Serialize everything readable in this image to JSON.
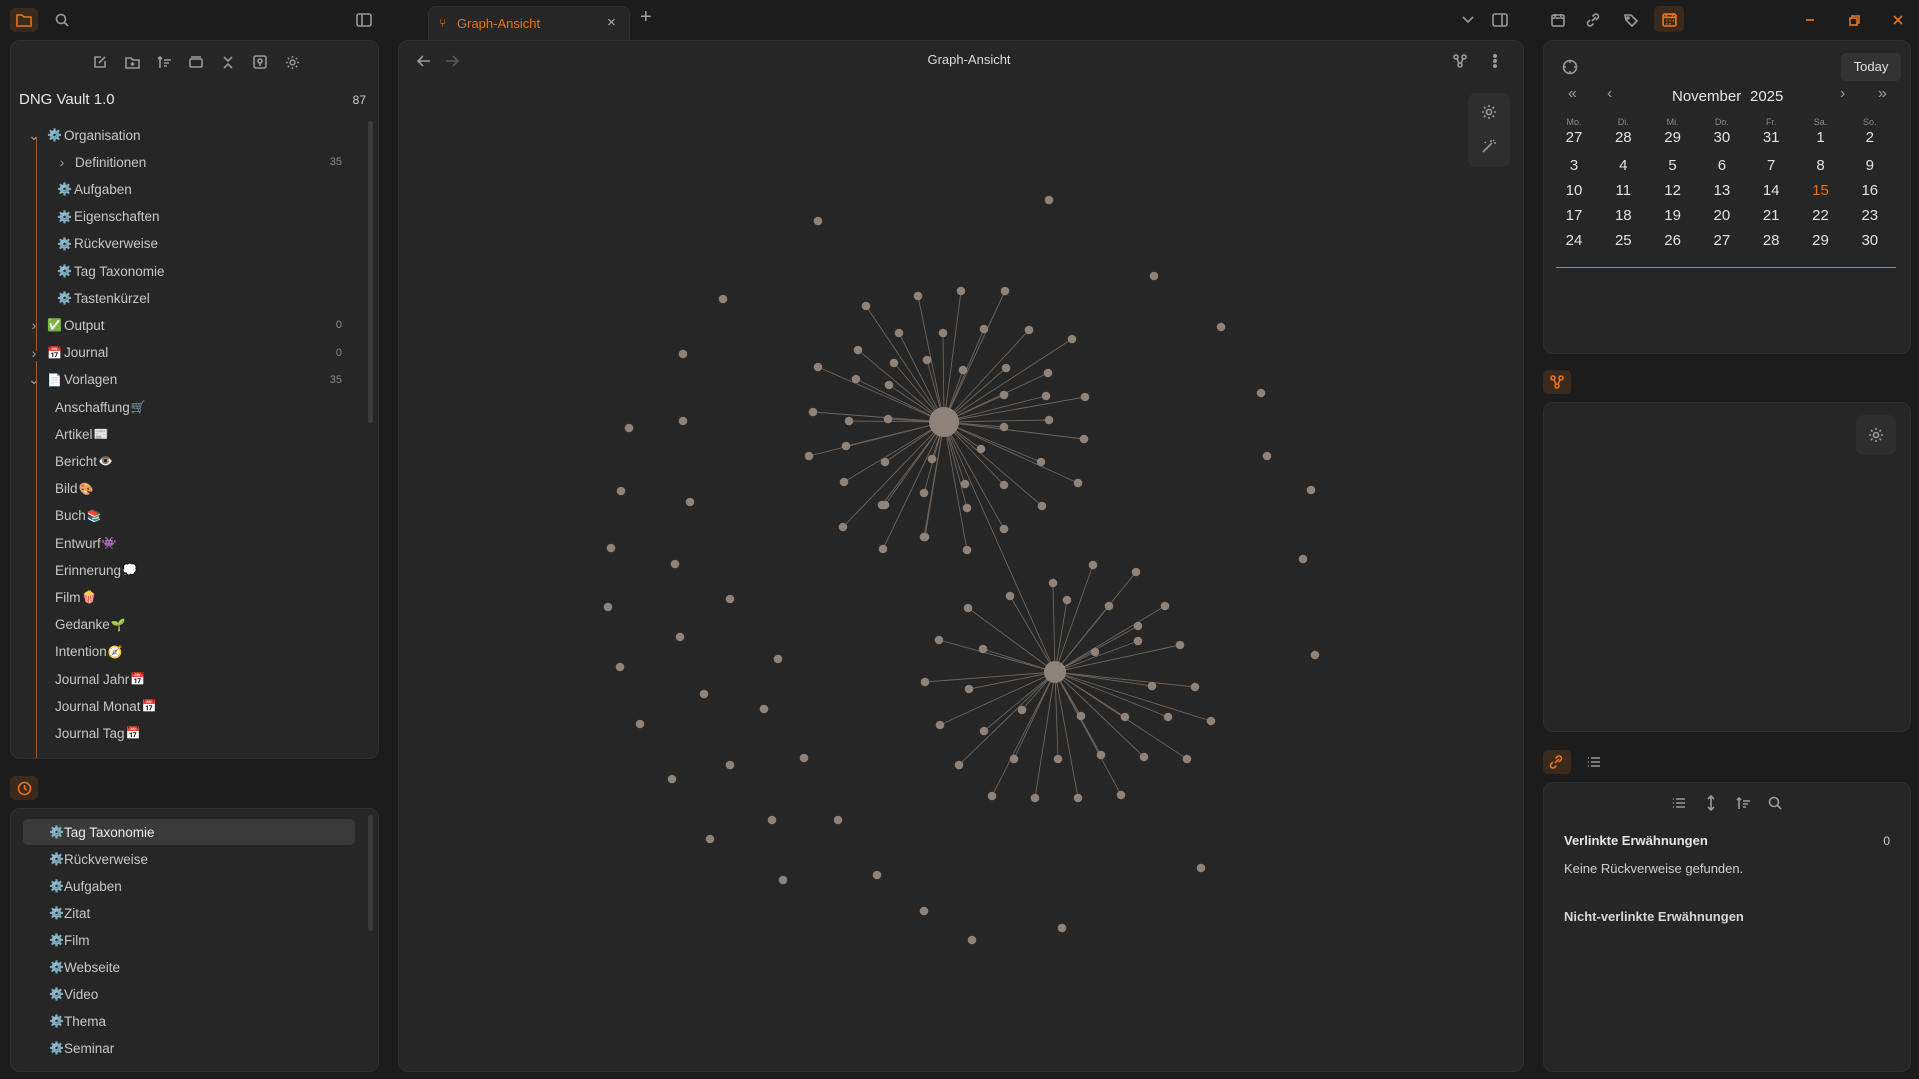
{
  "titlebar": {
    "tab_title": "Graph-Ansicht",
    "window_buttons": [
      "minimize-icon",
      "restore-icon",
      "close-icon"
    ]
  },
  "graph_view": {
    "title": "Graph-Ansicht",
    "node_color": "#8f8379",
    "edge_color": "#6e655d"
  },
  "explorer": {
    "vault_name": "DNG Vault 1.0",
    "vault_count": "87",
    "items": [
      {
        "label": "Organisation",
        "emoji": "⚙️",
        "chevron": "open",
        "count": ""
      },
      {
        "label": "Definitionen",
        "emoji": "",
        "chevron": "closed",
        "count": "35"
      },
      {
        "label": "Aufgaben",
        "emoji": "⚙️",
        "chevron": "",
        "count": ""
      },
      {
        "label": "Eigenschaften",
        "emoji": "⚙️",
        "chevron": "",
        "count": ""
      },
      {
        "label": "Rückverweise",
        "emoji": "⚙️",
        "chevron": "",
        "count": ""
      },
      {
        "label": "Tag Taxonomie",
        "emoji": "⚙️",
        "chevron": "",
        "count": ""
      },
      {
        "label": "Tastenkürzel",
        "emoji": "⚙️",
        "chevron": "",
        "count": ""
      },
      {
        "label": "Output",
        "emoji": "✅",
        "chevron": "closed",
        "count": "0"
      },
      {
        "label": "Journal",
        "emoji": "📅",
        "chevron": "closed",
        "count": "0"
      },
      {
        "label": "Vorlagen",
        "emoji": "📄",
        "chevron": "open",
        "count": "35"
      },
      {
        "label": "Anschaffung",
        "emoji_after": "🛒",
        "count": ""
      },
      {
        "label": "Artikel",
        "emoji_after": "📰",
        "count": ""
      },
      {
        "label": "Bericht",
        "emoji_after": "👁️",
        "count": ""
      },
      {
        "label": "Bild",
        "emoji_after": "🎨",
        "count": ""
      },
      {
        "label": "Buch",
        "emoji_after": "📚",
        "count": ""
      },
      {
        "label": "Entwurf",
        "emoji_after": "👾",
        "count": ""
      },
      {
        "label": "Erinnerung",
        "emoji_after": "💭",
        "count": ""
      },
      {
        "label": "Film",
        "emoji_after": "🍿",
        "count": ""
      },
      {
        "label": "Gedanke",
        "emoji_after": "🌱",
        "count": ""
      },
      {
        "label": "Intention",
        "emoji_after": "🧭",
        "count": ""
      },
      {
        "label": "Journal Jahr",
        "emoji_after": "📅",
        "count": ""
      },
      {
        "label": "Journal Monat",
        "emoji_after": "📅",
        "count": ""
      },
      {
        "label": "Journal Tag",
        "emoji_after": "📅",
        "count": ""
      }
    ]
  },
  "recent": {
    "items": [
      {
        "label": "Tag Taxonomie",
        "emoji": "⚙️"
      },
      {
        "label": "Rückverweise",
        "emoji": "⚙️"
      },
      {
        "label": "Aufgaben",
        "emoji": "⚙️"
      },
      {
        "label": "Zitat",
        "emoji": "⚙️"
      },
      {
        "label": "Film",
        "emoji": "⚙️"
      },
      {
        "label": "Webseite",
        "emoji": "⚙️"
      },
      {
        "label": "Video",
        "emoji": "⚙️"
      },
      {
        "label": "Thema",
        "emoji": "⚙️"
      },
      {
        "label": "Seminar",
        "emoji": "⚙️"
      }
    ]
  },
  "calendar": {
    "today_label": "Today",
    "month": "November",
    "year": "2025",
    "weekdays": [
      "Mo.",
      "Di.",
      "Mi.",
      "Do.",
      "Fr.",
      "Sa.",
      "So."
    ],
    "weeks": [
      [
        "27",
        "28",
        "29",
        "30",
        "31",
        "1",
        "2"
      ],
      [
        "3",
        "4",
        "5",
        "6",
        "7",
        "8",
        "9"
      ],
      [
        "10",
        "11",
        "12",
        "13",
        "14",
        "15",
        "16"
      ],
      [
        "17",
        "18",
        "19",
        "20",
        "21",
        "22",
        "23"
      ],
      [
        "24",
        "25",
        "26",
        "27",
        "28",
        "29",
        "30"
      ]
    ],
    "today": "15",
    "accent_color": "#e8731a"
  },
  "backlinks": {
    "linked_title": "Verlinkte Erwähnungen",
    "linked_count": "0",
    "empty_text": "Keine Rückverweise gefunden.",
    "unlinked_title": "Nicht-verlinkte Erwähnungen"
  }
}
